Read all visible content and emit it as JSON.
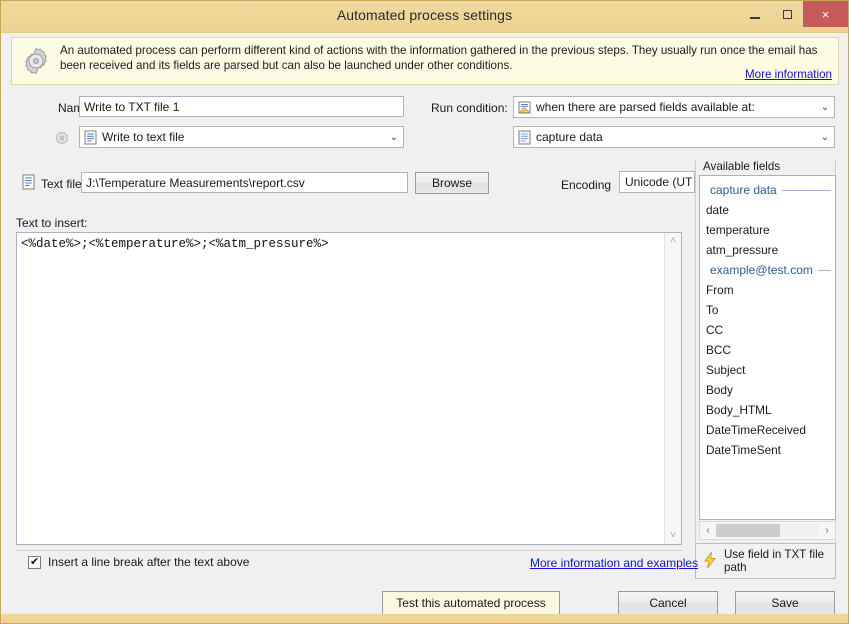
{
  "window": {
    "title": "Automated process settings",
    "minimize_label": "minimize",
    "maximize_label": "maximize",
    "close_label": "×"
  },
  "banner": {
    "icon": "gear-icon",
    "text": "An automated process can perform different kind of actions with the information gathered in the previous steps. They usually run once the email has been received and its fields are parsed but can also be launched under other conditions.",
    "link": "More information"
  },
  "form": {
    "name_label": "Name:",
    "name_value": "Write to TXT file 1",
    "action_icon": "gear-small-icon",
    "action_combo": {
      "icon": "text-document-icon",
      "value": "Write to text file",
      "chevron": "⌄"
    },
    "run_condition_label": "Run condition:",
    "run_condition_combo": {
      "icon": "clipboard-icon",
      "value": "when there are parsed fields available at:",
      "chevron": "⌄"
    },
    "source_combo": {
      "icon": "blue-document-icon",
      "value": "capture data",
      "chevron": "⌄"
    },
    "text_file_label": "Text file",
    "text_file_icon": "text-document-icon",
    "text_file_value": "J:\\Temperature Measurements\\report.csv",
    "browse_label": "Browse",
    "encoding_label": "Encoding",
    "encoding_value": "Unicode (UT"
  },
  "editor": {
    "label": "Text to insert:",
    "content": "<%date%>;<%temperature%>;<%atm_pressure%>",
    "scroll_up": "˄",
    "scroll_down": "˅"
  },
  "available_fields": {
    "legend": "Available fields",
    "items": [
      {
        "type": "header",
        "label": "capture data"
      },
      {
        "type": "field",
        "label": "date"
      },
      {
        "type": "field",
        "label": "temperature"
      },
      {
        "type": "field",
        "label": "atm_pressure"
      },
      {
        "type": "header",
        "label": "example@test.com"
      },
      {
        "type": "field",
        "label": "From"
      },
      {
        "type": "field",
        "label": "To"
      },
      {
        "type": "field",
        "label": "CC"
      },
      {
        "type": "field",
        "label": "BCC"
      },
      {
        "type": "field",
        "label": "Subject"
      },
      {
        "type": "field",
        "label": "Body"
      },
      {
        "type": "field",
        "label": "Body_HTML"
      },
      {
        "type": "field",
        "label": "DateTimeReceived"
      },
      {
        "type": "field",
        "label": "DateTimeSent"
      }
    ],
    "hscroll_left": "‹",
    "hscroll_right": "›",
    "use_field_button": {
      "icon": "lightning-bolt-icon",
      "label": "Use field in TXT file path"
    }
  },
  "bottom": {
    "checkbox_label": "Insert a line break after the text above",
    "checkbox_checked": true,
    "link": "More information and examples",
    "test_button": "Test this automated process",
    "cancel_button": "Cancel",
    "save_button": "Save"
  },
  "colors": {
    "titlebar": "#eed597",
    "banner_bg": "#fdfbe3",
    "close_button": "#c75b5b",
    "link": "#1414cf",
    "group_header": "#2f5a96",
    "accent_button": "#fbf8e0"
  }
}
